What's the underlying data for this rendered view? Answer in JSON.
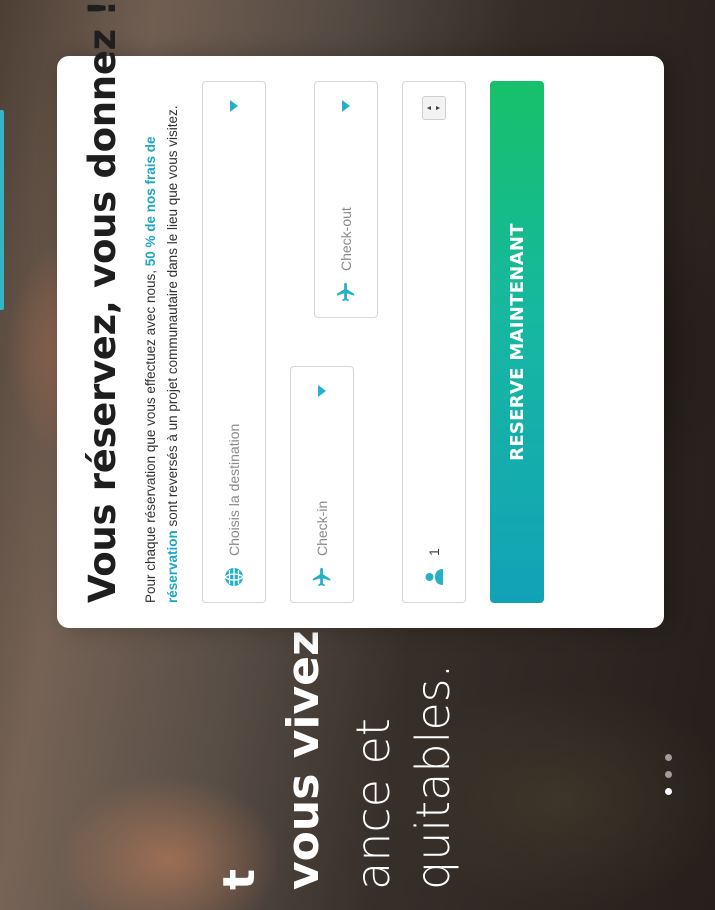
{
  "hero": {
    "line1": "t",
    "line2": "vous vivez",
    "line3": "ance et",
    "line4": "quitables."
  },
  "carousel": {
    "dot_count": 3,
    "active_index": 0
  },
  "booking": {
    "title": "Vous réservez, vous donnez !",
    "description_part1": "Pour chaque réservation que vous effectuez avec nous, ",
    "description_highlight": "50 % de nos frais de réservation",
    "description_part2": " sont reversés à un projet communautaire dans le lieu que vous visitez.",
    "destination_placeholder": "Choisis la destination",
    "checkin_label": "Check-in",
    "checkout_label": "Check-out",
    "guests_value": "1",
    "cta_label": "RESERVE MAINTENANT"
  },
  "colors": {
    "accent": "#1aa7c5",
    "cta_start": "#12a2b8",
    "cta_end": "#17c06a"
  },
  "icons": {
    "destination": "globe-icon",
    "checkin": "plane-icon",
    "checkout": "plane-icon",
    "guests": "user-icon",
    "dropdown": "caret-down-icon"
  }
}
